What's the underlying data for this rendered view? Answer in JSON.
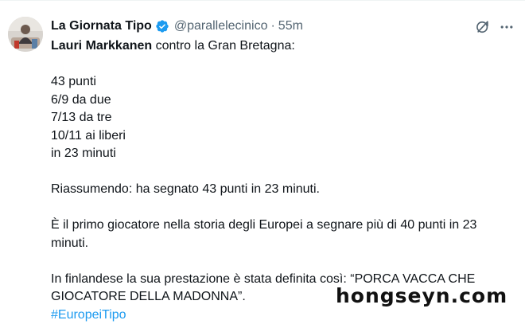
{
  "author": {
    "display_name": "La Giornata Tipo",
    "handle": "@parallelecinico",
    "separator": "·",
    "timestamp": "55m",
    "verified": true,
    "verified_color": "#1d9bf0"
  },
  "actions": {
    "grok_icon": "grok-icon",
    "more_icon": "more-icon"
  },
  "tweet": {
    "mention_name": "Lauri Markkanen",
    "line1_rest": " contro la Gran Bretagna:",
    "stats": [
      "43 punti",
      "6/9 da due",
      "7/13 da tre",
      "10/11 ai liberi",
      "in 23 minuti"
    ],
    "summary": "Riassumendo: ha segnato 43 punti in 23 minuti.",
    "history_line1": "È il primo giocatore nella storia degli Europei a segnare più di 40 punti in 23",
    "history_line2": "minuti.",
    "finnish_line1": "In finlandese la sua prestazione è stata definita così: “PORCA VACCA CHE",
    "finnish_line2": "GIOCATORE DELLA MADONNA”.",
    "hashtag": "#EuropeiTipo"
  },
  "watermark": "hongseyn.com",
  "colors": {
    "text": "#0f1419",
    "secondary": "#536471",
    "link": "#1d9bf0"
  }
}
